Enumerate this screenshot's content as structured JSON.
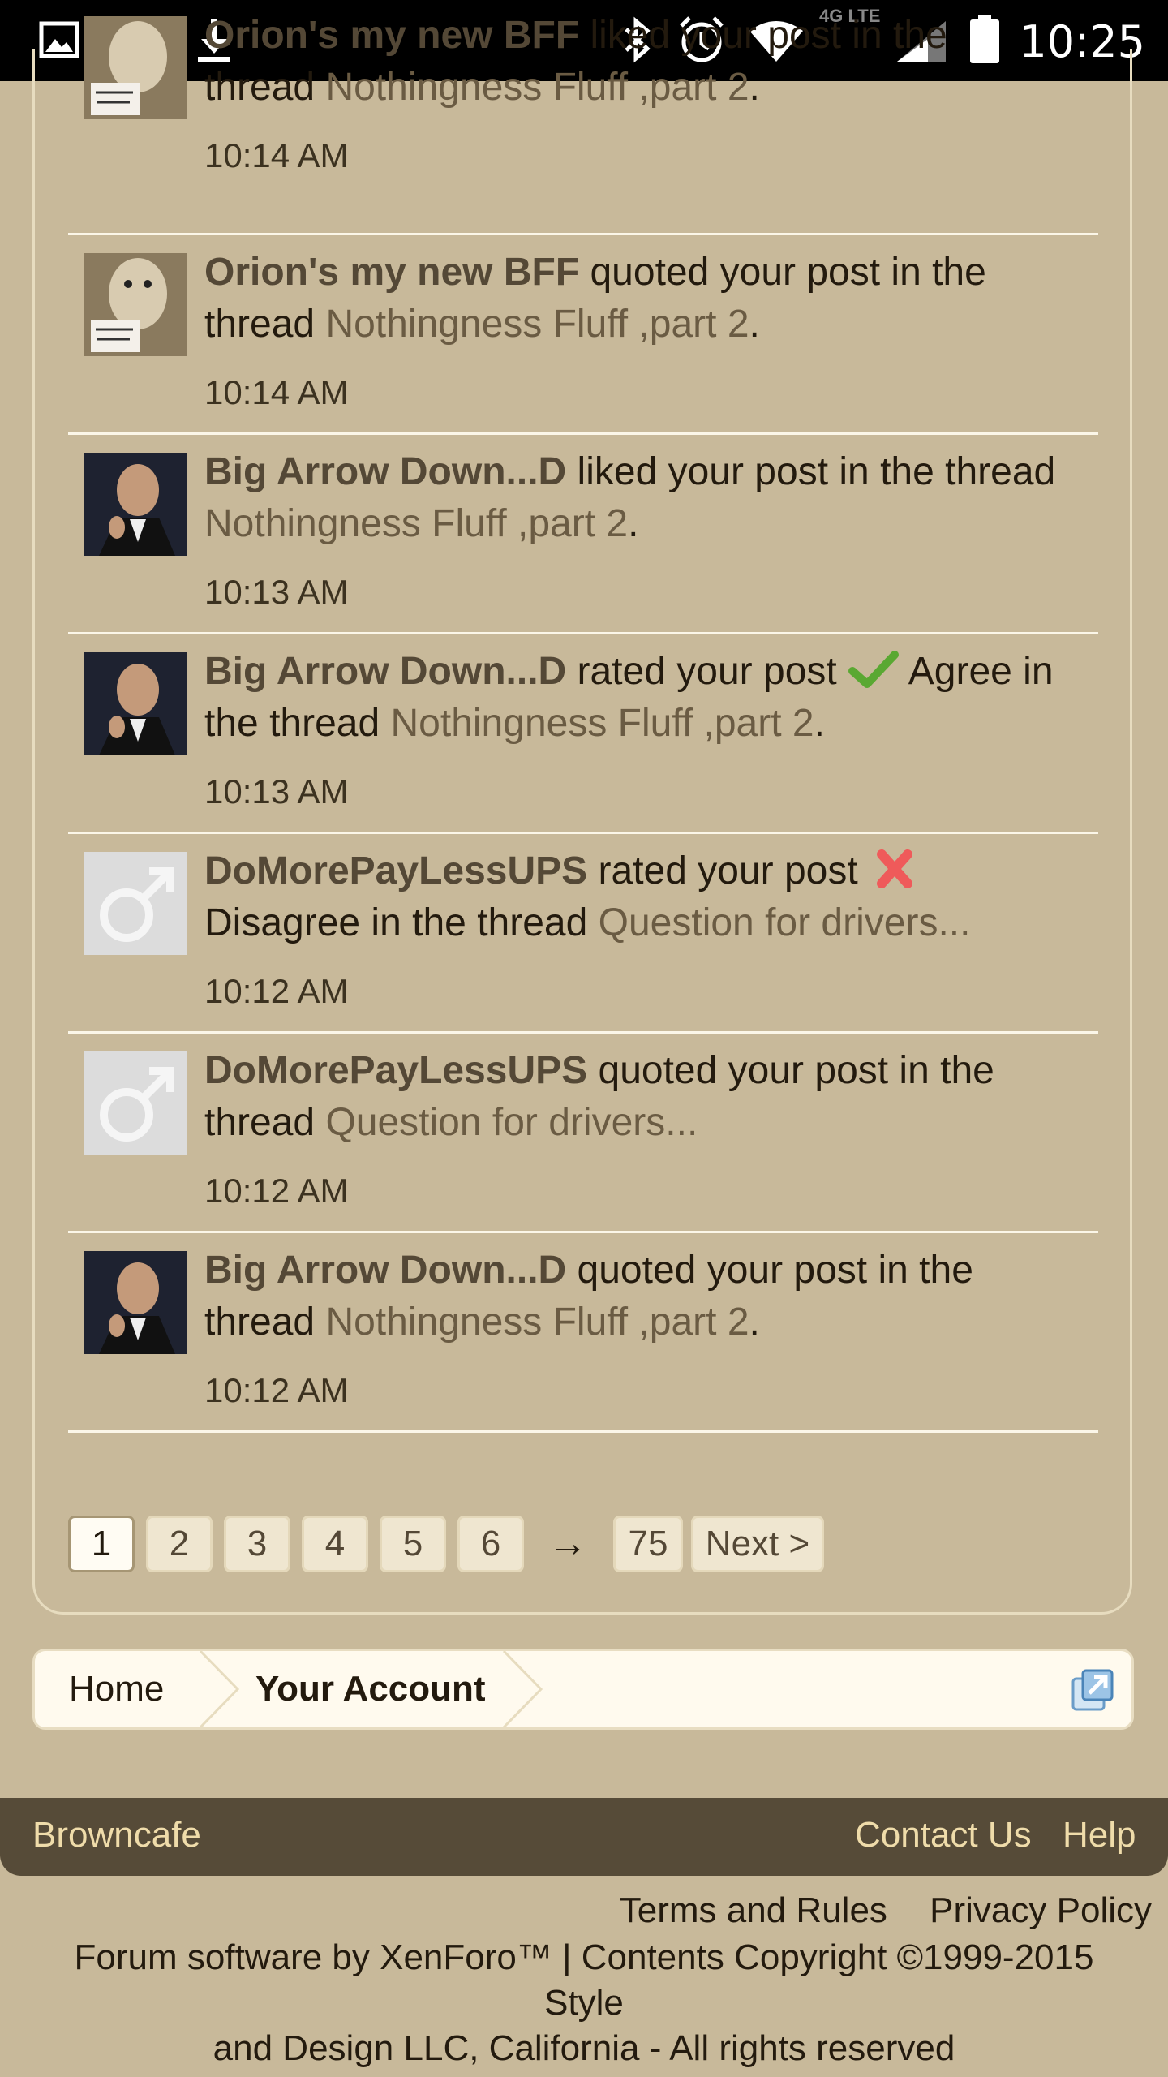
{
  "status_bar": {
    "time": "10:25",
    "network": "4G LTE",
    "icons": [
      "image-icon",
      "mail-icon",
      "download-icon",
      "bluetooth-icon",
      "alarm-icon",
      "wifi-icon",
      "signal-icon",
      "battery-icon"
    ]
  },
  "notifications": [
    {
      "user": "Orion's my new BFF",
      "action": " liked your post in the thread ",
      "thread": "Nothingness Fluff ,part 2",
      "suffix": ".",
      "time": "10:14 AM",
      "avatar": "dog-avatar"
    },
    {
      "user": "Orion's my new BFF",
      "action": " quoted your post in the thread ",
      "thread": "Nothingness Fluff ,part 2",
      "suffix": ".",
      "time": "10:14 AM",
      "avatar": "dog-avatar"
    },
    {
      "user": "Big Arrow Down...D",
      "action": " liked your post in the thread ",
      "thread": "Nothingness Fluff ,part 2",
      "suffix": ".",
      "time": "10:13 AM",
      "avatar": "godfather-avatar"
    },
    {
      "user": "Big Arrow Down...D",
      "action": " rated your post ",
      "rating": "Agree",
      "rating_icon": "check-icon",
      "action2": " in the thread ",
      "thread": "Nothingness Fluff ,part 2",
      "suffix": ".",
      "time": "10:13 AM",
      "avatar": "godfather-avatar"
    },
    {
      "user": "DoMorePayLessUPS",
      "action": " rated your post ",
      "rating": "Disagree",
      "rating_icon": "x-icon",
      "action2": " in the thread ",
      "thread": "Question for drivers...",
      "suffix": "",
      "time": "10:12 AM",
      "avatar": "male-symbol-avatar"
    },
    {
      "user": "DoMorePayLessUPS",
      "action": " quoted your post in the thread ",
      "thread": "Question for drivers...",
      "suffix": "",
      "time": "10:12 AM",
      "avatar": "male-symbol-avatar"
    },
    {
      "user": "Big Arrow Down...D",
      "action": " quoted your post in the thread ",
      "thread": "Nothingness Fluff ,part 2",
      "suffix": ".",
      "time": "10:12 AM",
      "avatar": "godfather-avatar"
    }
  ],
  "pagination": {
    "pages": [
      "1",
      "2",
      "3",
      "4",
      "5",
      "6"
    ],
    "current": "1",
    "gap": "→",
    "last": "75",
    "next": "Next >"
  },
  "breadcrumb": {
    "items": [
      "Home",
      "Your Account"
    ],
    "jump_icon": "jump-to-icon"
  },
  "footer": {
    "site": "Browncafe",
    "contact": "Contact Us",
    "help": "Help",
    "terms": "Terms and Rules",
    "privacy": "Privacy Policy",
    "copyright_line1": "Forum software by XenForo™ | Contents Copyright ©1999-2015 Style",
    "copyright_line2": "and Design LLC, California - All rights reserved"
  },
  "colors": {
    "background": "#c8b99a",
    "username": "#544836",
    "thread_link": "#6a5b43",
    "footer_bar": "#564b38",
    "footer_link": "#efdcaa",
    "divider": "#fbf6e8"
  }
}
